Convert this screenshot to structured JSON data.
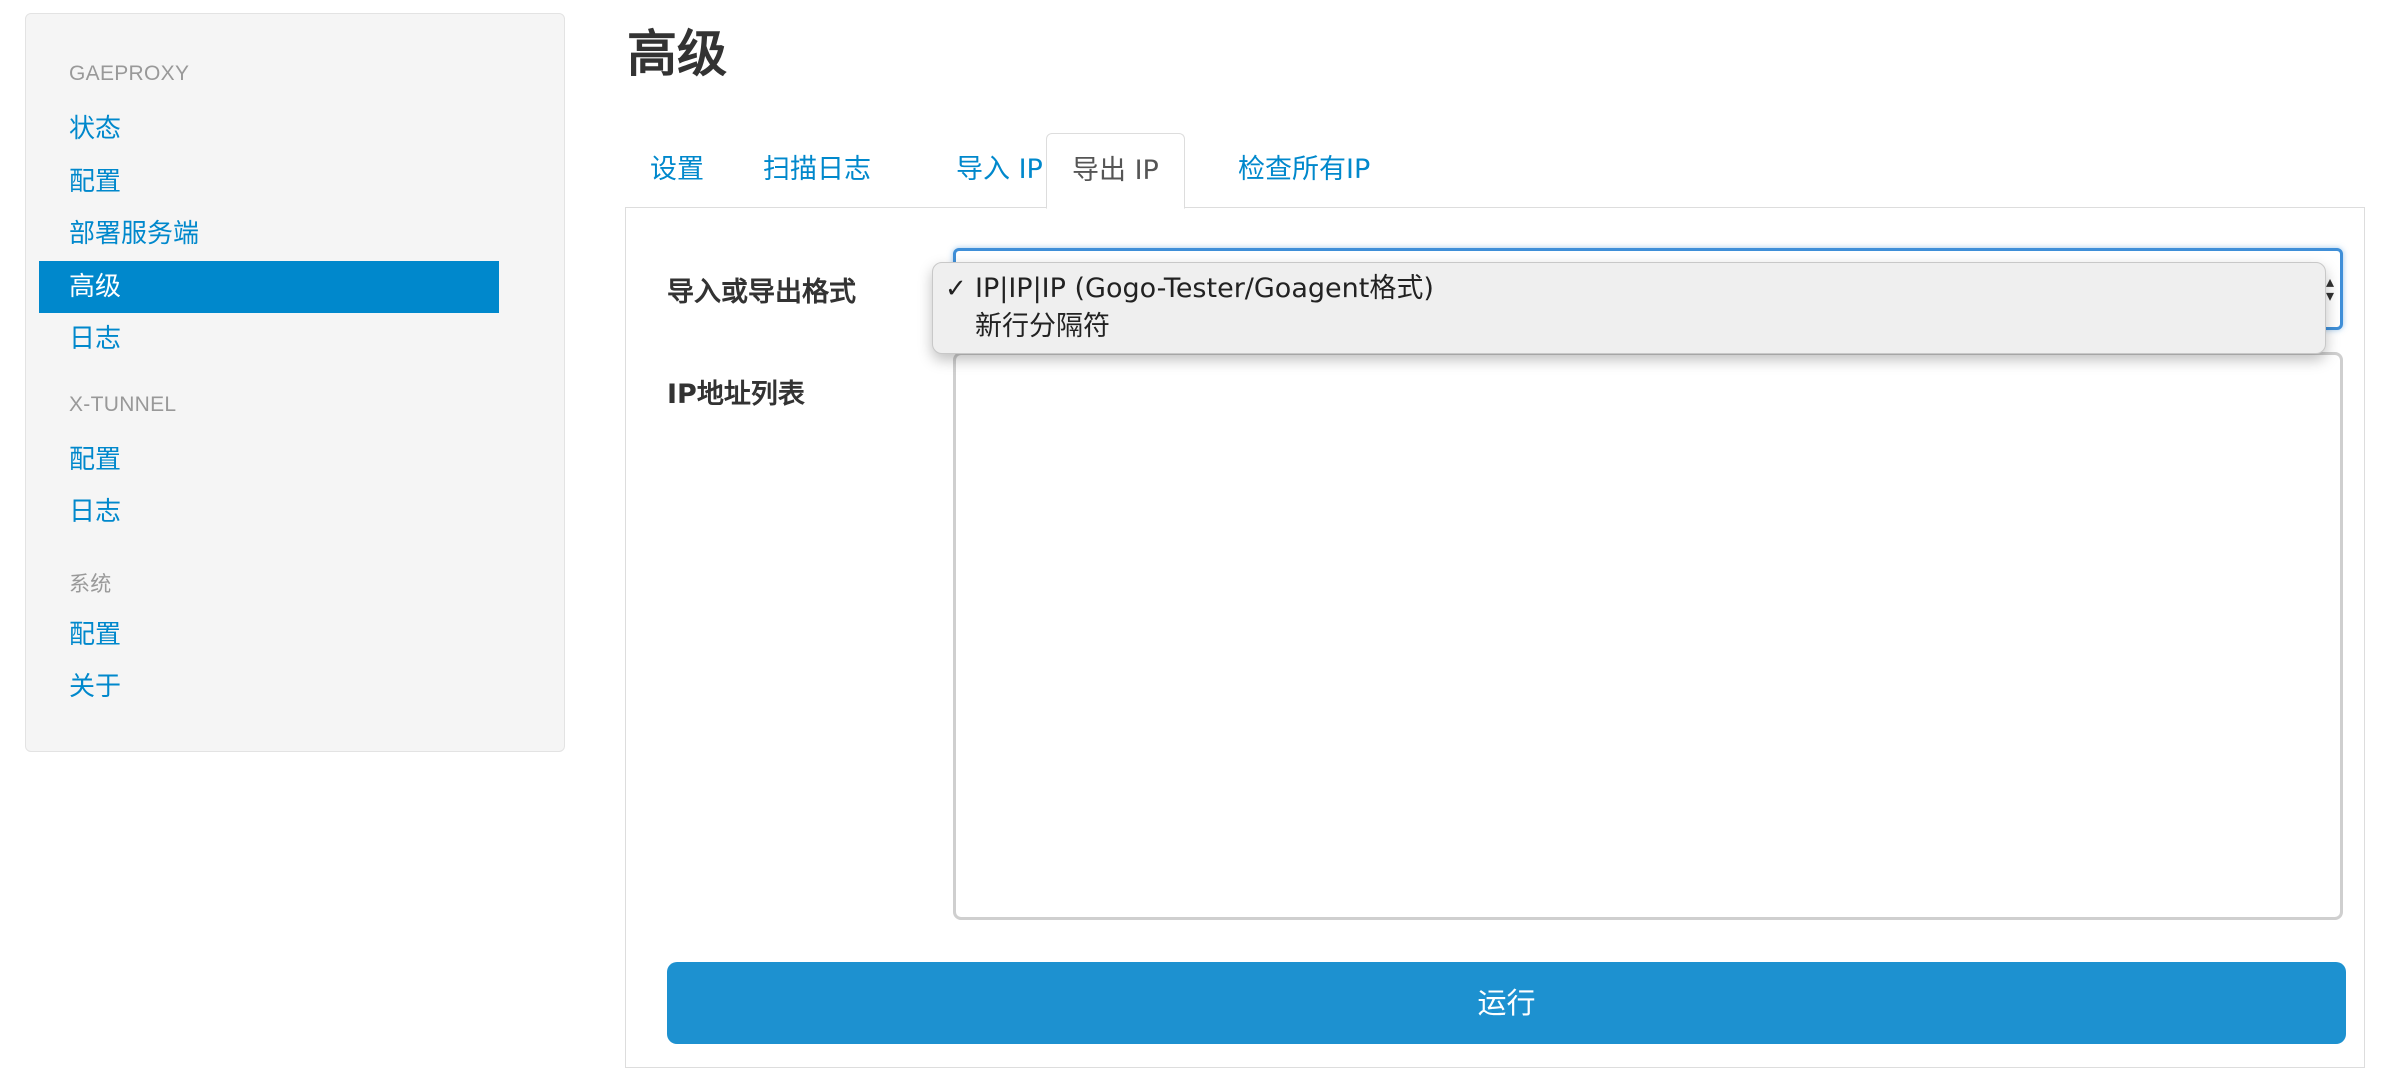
{
  "sidebar": {
    "sections": [
      {
        "header": "GAEPROXY",
        "items": [
          "状态",
          "配置",
          "部署服务端",
          "高级",
          "日志"
        ]
      },
      {
        "header": "X-TUNNEL",
        "items": [
          "配置",
          "日志"
        ]
      },
      {
        "header": "系统",
        "items": [
          "配置",
          "关于"
        ]
      }
    ],
    "active_item": "高级"
  },
  "main": {
    "title": "高级",
    "tabs": [
      {
        "label": "设置",
        "active": false
      },
      {
        "label": "扫描日志",
        "active": false
      },
      {
        "label": "导入 IP",
        "active": false
      },
      {
        "label": "导出 IP",
        "active": true
      },
      {
        "label": "检查所有IP",
        "active": false
      }
    ],
    "form": {
      "format_label": "导入或导出格式",
      "format_options": [
        "IP|IP|IP (Gogo-Tester/Goagent格式)",
        "新行分隔符"
      ],
      "format_selected": "IP|IP|IP (Gogo-Tester/Goagent格式)",
      "checkmark": "✓",
      "ip_list_label": "IP地址列表",
      "ip_list_value": "",
      "run_label": "运行"
    }
  },
  "colors": {
    "accent": "#0088cc",
    "button": "#1d91d0",
    "focus": "#3f8fd8"
  }
}
